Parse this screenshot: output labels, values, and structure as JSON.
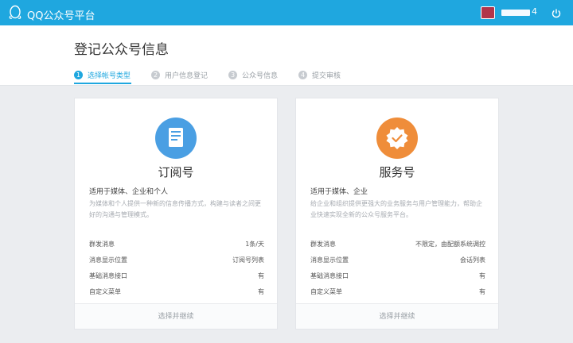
{
  "app": {
    "name": "QQ公众号平台"
  },
  "user": {
    "name_partial": "4"
  },
  "page": {
    "title": "登记公众号信息"
  },
  "steps": [
    {
      "num": "1",
      "label": "选择帐号类型"
    },
    {
      "num": "2",
      "label": "用户信息登记"
    },
    {
      "num": "3",
      "label": "公众号信息"
    },
    {
      "num": "4",
      "label": "提交审核"
    }
  ],
  "cards": [
    {
      "title": "订阅号",
      "audience": "适用于媒体、企业和个人",
      "description": "为媒体和个人提供一种新的信息传播方式，构建与读者之间更好的沟通与管理模式。",
      "rows": [
        {
          "label": "群发消息",
          "value": "1条/天"
        },
        {
          "label": "消息显示位置",
          "value": "订阅号列表"
        },
        {
          "label": "基础消息接口",
          "value": "有"
        },
        {
          "label": "自定义菜单",
          "value": "有"
        }
      ],
      "action": "选择并继续",
      "icon": "document-icon",
      "color": "#4a9fe3"
    },
    {
      "title": "服务号",
      "audience": "适用于媒体、企业",
      "description": "给企业和组织提供更强大的业务服务与用户管理能力，帮助企业快速实现全新的公众号服务平台。",
      "rows": [
        {
          "label": "群发消息",
          "value": "不限定，由配额系统调控"
        },
        {
          "label": "消息显示位置",
          "value": "会话列表"
        },
        {
          "label": "基础消息接口",
          "value": "有"
        },
        {
          "label": "自定义菜单",
          "value": "有"
        }
      ],
      "action": "选择并继续",
      "icon": "verified-badge-icon",
      "color": "#ef8d3a"
    }
  ]
}
